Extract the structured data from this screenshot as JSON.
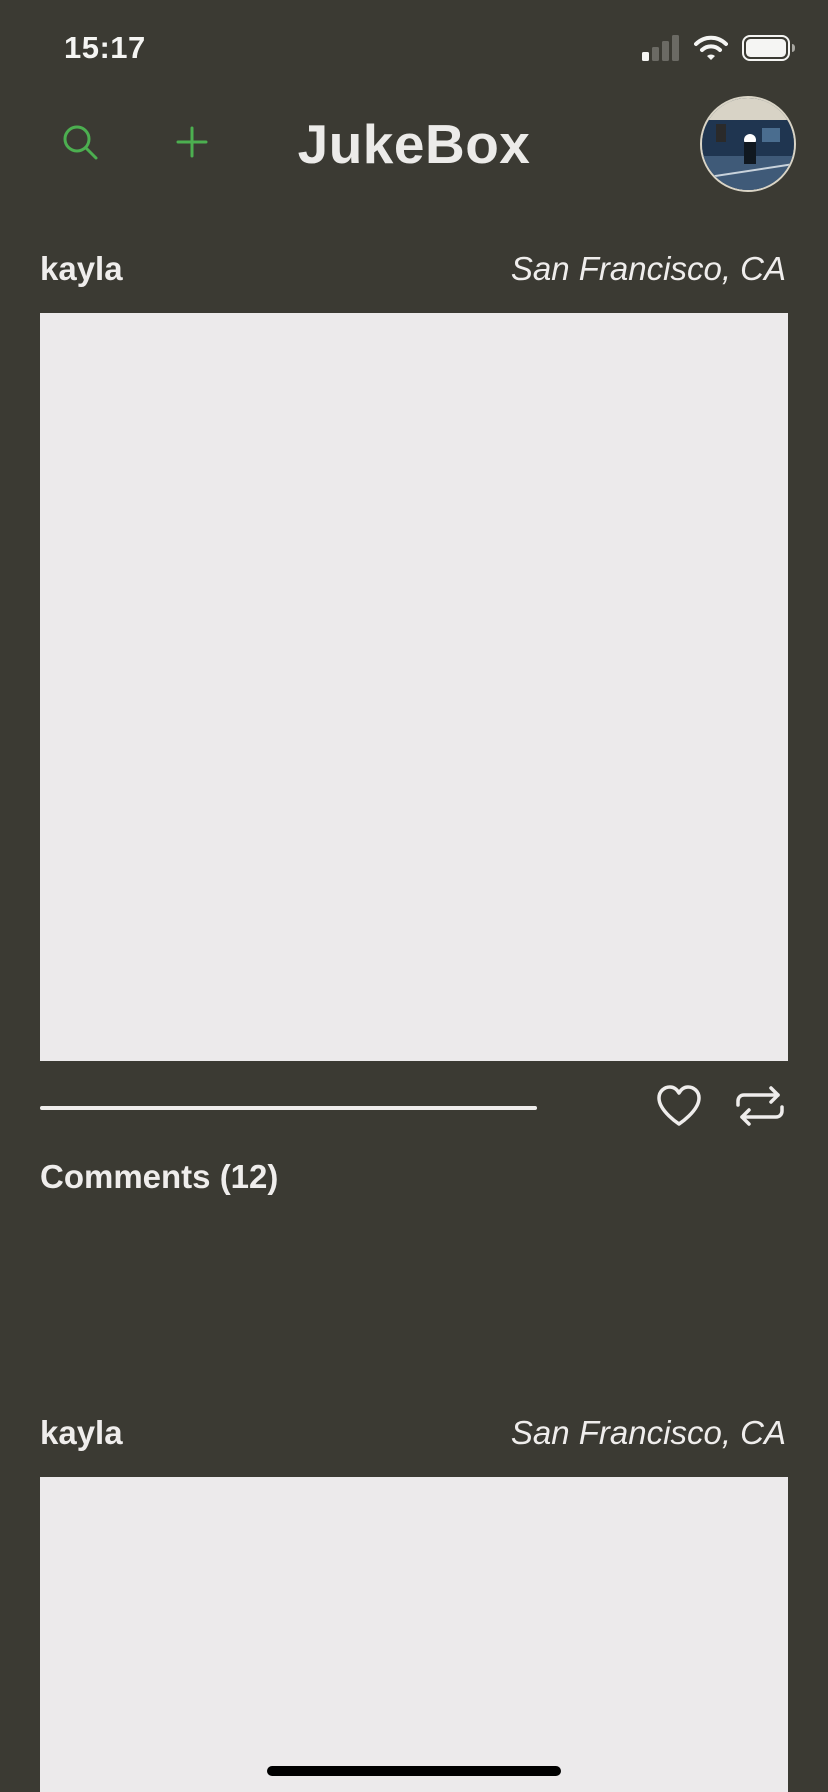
{
  "status_bar": {
    "time": "15:17"
  },
  "nav": {
    "title": "JukeBox",
    "search_icon": "search-icon",
    "add_icon": "plus-icon",
    "accent_color": "#4caf50"
  },
  "posts": [
    {
      "user": "kayla",
      "location": "San Francisco, CA",
      "progress": 1.0,
      "comments_label": "Comments (12)"
    },
    {
      "user": "kayla",
      "location": "San Francisco, CA"
    }
  ]
}
